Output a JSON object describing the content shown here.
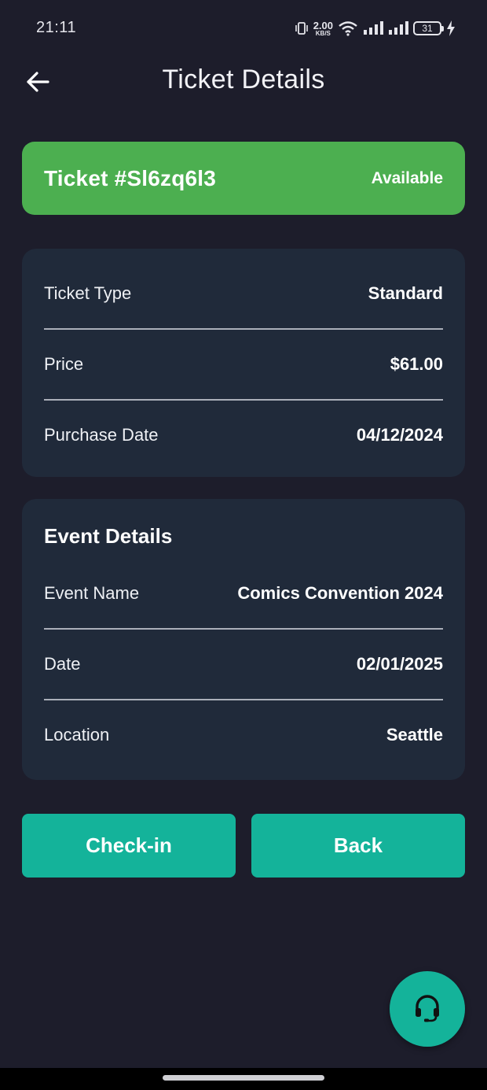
{
  "status_bar": {
    "time": "21:11",
    "net_speed_value": "2.00",
    "net_speed_unit": "KB/S",
    "battery": "31",
    "icons": [
      "vibrate-icon",
      "wifi-icon",
      "signal-icon",
      "signal-icon",
      "battery-icon",
      "charging-icon"
    ]
  },
  "app_bar": {
    "title": "Ticket Details",
    "back_icon": "arrow-left-icon"
  },
  "ticket": {
    "id_label": "Ticket #Sl6zq6l3",
    "status": "Available",
    "status_color": "#4caf50"
  },
  "ticket_info": {
    "rows": [
      {
        "label": "Ticket Type",
        "value": "Standard"
      },
      {
        "label": "Price",
        "value": "$61.00"
      },
      {
        "label": "Purchase Date",
        "value": "04/12/2024"
      }
    ]
  },
  "event_details": {
    "title": "Event Details",
    "rows": [
      {
        "label": "Event Name",
        "value": "Comics Convention 2024"
      },
      {
        "label": "Date",
        "value": "02/01/2025"
      },
      {
        "label": "Location",
        "value": "Seattle"
      }
    ]
  },
  "actions": {
    "checkin_label": "Check-in",
    "back_label": "Back",
    "accent_color": "#14b39a"
  },
  "fab": {
    "icon": "headset-icon"
  },
  "colors": {
    "background": "#1d1d2b",
    "card": "#202a3a"
  }
}
